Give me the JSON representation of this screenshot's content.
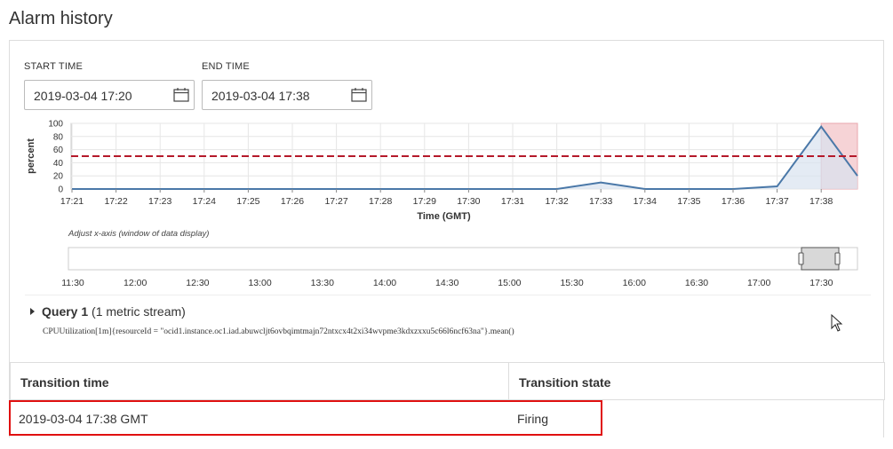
{
  "page": {
    "title": "Alarm history"
  },
  "form": {
    "start_label": "START TIME",
    "start_value": "2019-03-04 17:20",
    "end_label": "END TIME",
    "end_value": "2019-03-04 17:38"
  },
  "chart_data": {
    "type": "area",
    "ylabel": "percent",
    "xlabel": "Time (GMT)",
    "ylim": [
      0,
      100
    ],
    "yticks": [
      0,
      20,
      40,
      60,
      80,
      100
    ],
    "categories": [
      "17:21",
      "17:22",
      "17:23",
      "17:24",
      "17:25",
      "17:26",
      "17:27",
      "17:28",
      "17:29",
      "17:30",
      "17:31",
      "17:32",
      "17:33",
      "17:34",
      "17:35",
      "17:36",
      "17:37",
      "17:38"
    ],
    "series": [
      {
        "x": [
          "17:21",
          "17:22",
          "17:23",
          "17:24",
          "17:25",
          "17:26",
          "17:27",
          "17:28",
          "17:29",
          "17:30",
          "17:31",
          "17:32",
          "17:33",
          "17:34",
          "17:35",
          "17:36",
          "17:37",
          "17:38",
          "17:38+"
        ],
        "values": [
          0,
          0,
          0,
          0,
          0,
          0,
          0,
          0,
          0,
          0,
          0,
          0,
          10,
          0,
          0,
          0,
          4,
          95,
          20
        ]
      }
    ],
    "threshold": 50,
    "alarm_window_start": "17:38",
    "colors": {
      "line": "#4a78a8",
      "fill": "#d9e2ef",
      "threshold": "#b5192a",
      "alarm": "#f6d3d6"
    },
    "grid": true
  },
  "navigator": {
    "caption": "Adjust x-axis (window of data display)",
    "ticks": [
      "11:30",
      "12:00",
      "12:30",
      "13:00",
      "13:30",
      "14:00",
      "14:30",
      "15:00",
      "15:30",
      "16:00",
      "16:30",
      "17:00",
      "17:30"
    ]
  },
  "query": {
    "name": "Query 1",
    "detail": "(1 metric stream)",
    "expression": "CPUUtilization[1m]{resourceId = \"ocid1.instance.oc1.iad.abuwcljt6ovbqimtmajn72ntxcx4t2xi34wvpme3kdxzxxu5c66l6ncf63na\"}.mean()"
  },
  "table": {
    "headers": [
      "Transition time",
      "Transition state"
    ],
    "rows": [
      [
        "2019-03-04 17:38 GMT",
        "Firing"
      ]
    ]
  }
}
